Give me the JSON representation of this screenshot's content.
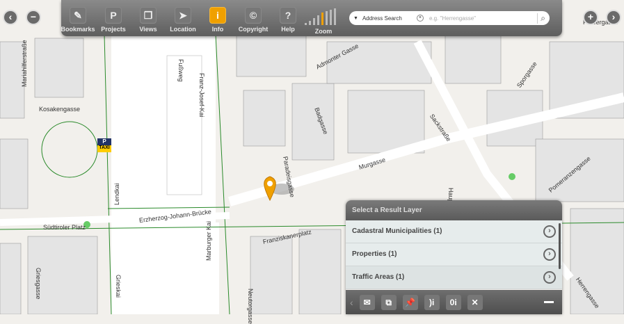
{
  "toolbar": {
    "items": [
      {
        "label": "Bookmarks",
        "icon": "bookmark-icon",
        "glyph": "✎"
      },
      {
        "label": "Projects",
        "icon": "projects-icon",
        "glyph": "P"
      },
      {
        "label": "Views",
        "icon": "views-icon",
        "glyph": "❐"
      },
      {
        "label": "Location",
        "icon": "location-arrow-icon",
        "glyph": "➤"
      },
      {
        "label": "Info",
        "icon": "info-icon",
        "glyph": "i"
      },
      {
        "label": "Copyright",
        "icon": "copyright-icon",
        "glyph": "©"
      },
      {
        "label": "Help",
        "icon": "help-icon",
        "glyph": "?"
      }
    ],
    "zoom_label": "Zoom",
    "active": "Info",
    "accent": "#f0a000"
  },
  "search": {
    "mode": "Address Search",
    "placeholder": "e.g. \"Herrengasse\""
  },
  "panel": {
    "title": "Select a Result Layer",
    "rows": [
      "Cadastral Municipalities (1)",
      "Properties (1)",
      "Traffic Areas (1)"
    ]
  },
  "map": {
    "streets": [
      "Mariahilferstraße",
      "Kosakengasse",
      "Lendkai",
      "Südtiroler Platz",
      "Erzherzog-Johann-Brücke",
      "Fußweg",
      "Franz-Josef-Kai",
      "Admonter Gasse",
      "Badgasse",
      "Paradeisgasse",
      "Murgasse",
      "Sackstraße",
      "Sporgasse",
      "Färbergasse",
      "Hauptplatz",
      "Pomeranzengasse",
      "Herrengasse",
      "Franziskanerplatz",
      "Marburger Kai",
      "Neutorgasse",
      "Griesgasse",
      "Grieskai"
    ],
    "taxi": "TAXI",
    "parking": "P"
  }
}
